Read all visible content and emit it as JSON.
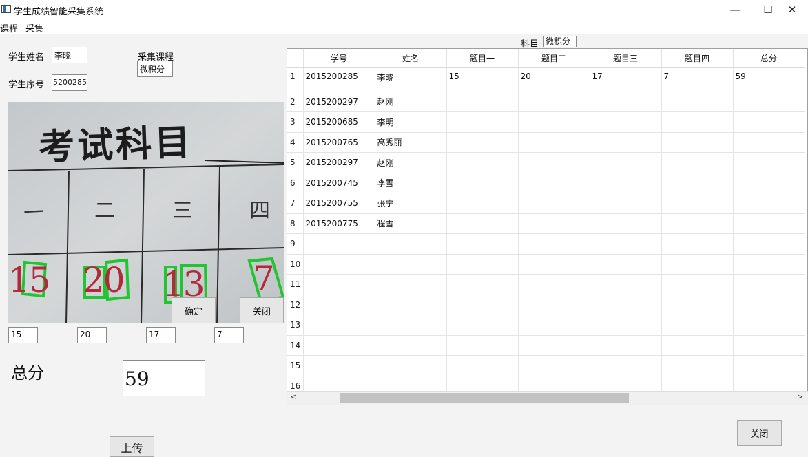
{
  "window": {
    "title": "学生成绩智能采集系统",
    "minimize": "—",
    "maximize": "☐",
    "close": "✕"
  },
  "menu": [
    "课程",
    "采集"
  ],
  "student": {
    "name_label": "学生姓名",
    "name_value": "李晓",
    "id_label": "学生序号",
    "id_value": "5200285"
  },
  "course": {
    "label": "采集课程",
    "value": "微积分"
  },
  "photo": {
    "heading": "考试科目",
    "columns": [
      "一",
      "二",
      "三",
      "四"
    ],
    "scores": [
      "15",
      "20",
      "13",
      "7"
    ]
  },
  "buttons": {
    "confirm": "确定",
    "close_small": "关闭",
    "close_main": "关闭",
    "upload": "上传"
  },
  "score_fields": [
    "15",
    "20",
    "17",
    "7"
  ],
  "total": {
    "label": "总分",
    "value": "59"
  },
  "subject": {
    "label": "科目",
    "value": "微积分"
  },
  "table": {
    "columns": [
      "学号",
      "姓名",
      "题目一",
      "题目二",
      "题目三",
      "题目四",
      "总分"
    ],
    "rows": [
      [
        "2015200285",
        "李晓",
        "15",
        "20",
        "17",
        "7",
        "59"
      ],
      [
        "2015200297",
        "赵刚",
        "",
        "",
        "",
        "",
        ""
      ],
      [
        "2015200685",
        "李明",
        "",
        "",
        "",
        "",
        ""
      ],
      [
        "2015200765",
        "高秀丽",
        "",
        "",
        "",
        "",
        ""
      ],
      [
        "2015200297",
        "赵刚",
        "",
        "",
        "",
        "",
        ""
      ],
      [
        "2015200745",
        "李雪",
        "",
        "",
        "",
        "",
        ""
      ],
      [
        "2015200755",
        "张宁",
        "",
        "",
        "",
        "",
        ""
      ],
      [
        "2015200775",
        "程雪",
        "",
        "",
        "",
        "",
        ""
      ],
      [
        "",
        "",
        "",
        "",
        "",
        "",
        ""
      ],
      [
        "",
        "",
        "",
        "",
        "",
        "",
        ""
      ],
      [
        "",
        "",
        "",
        "",
        "",
        "",
        ""
      ],
      [
        "",
        "",
        "",
        "",
        "",
        "",
        ""
      ],
      [
        "",
        "",
        "",
        "",
        "",
        "",
        ""
      ],
      [
        "",
        "",
        "",
        "",
        "",
        "",
        ""
      ],
      [
        "",
        "",
        "",
        "",
        "",
        "",
        ""
      ],
      [
        "",
        "",
        "",
        "",
        "",
        "",
        ""
      ]
    ],
    "row_numbers": [
      "1",
      "2",
      "3",
      "4",
      "5",
      "6",
      "7",
      "8",
      "9",
      "10",
      "11",
      "12",
      "13",
      "14",
      "15",
      "16"
    ]
  },
  "scrollbar": {
    "left_arrow": "<",
    "right_arrow": ">"
  }
}
